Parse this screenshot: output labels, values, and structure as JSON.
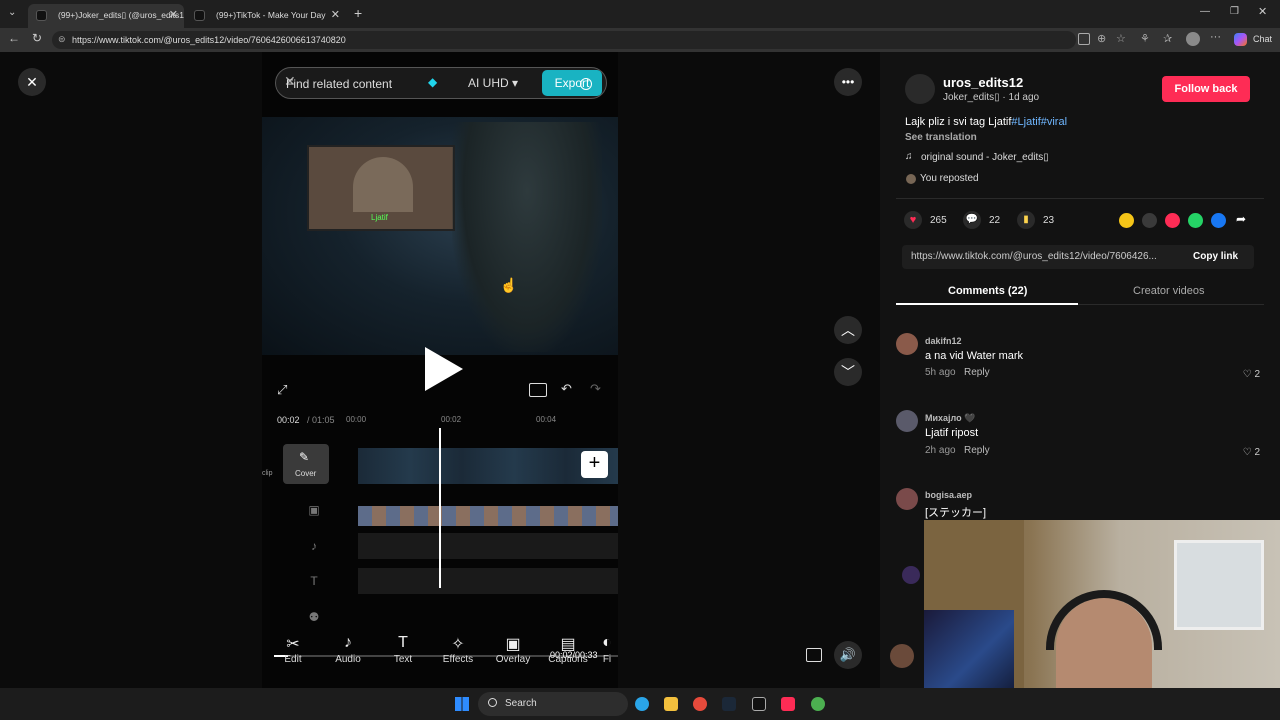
{
  "browser": {
    "tabs": [
      {
        "title": "(99+)Joker_edits▯ (@uros_edits12)",
        "active": true
      },
      {
        "title": "(99+)TikTok - Make Your Day",
        "active": false
      }
    ],
    "url": "https://www.tiktok.com/@uros_edits12/video/7606426006613740820",
    "chat_label": "Chat"
  },
  "editor": {
    "search_placeholder": "Find related content",
    "quality_label": "AI UHD ▾",
    "export_label": "Export",
    "current_time": "00:02",
    "total_time": "/ 01:05",
    "ticks": [
      "00:00",
      "00:02",
      "00:04"
    ],
    "cover_label": "Cover",
    "clip_label": "clip",
    "video_overlay_text": "Ljatif",
    "playback_time": "00:02/00:33",
    "tools": [
      {
        "label": "Edit",
        "icon": "scissors-icon"
      },
      {
        "label": "Audio",
        "icon": "music-note-icon"
      },
      {
        "label": "Text",
        "icon": "text-icon"
      },
      {
        "label": "Effects",
        "icon": "effects-star-icon"
      },
      {
        "label": "Overlay",
        "icon": "overlay-icon"
      },
      {
        "label": "Captions",
        "icon": "captions-icon"
      },
      {
        "label": "Fi",
        "icon": "filter-icon"
      }
    ]
  },
  "post": {
    "username": "uros_edits12",
    "display_meta": "Joker_edits▯ · 1d ago",
    "follow_label": "Follow back",
    "caption_text": "Lajk pliz i svi tag Ljatif",
    "caption_tags": "#Ljatif#viral",
    "see_translation": "See translation",
    "sound": "original sound - Joker_edits▯",
    "reposted": "You reposted",
    "likes": "265",
    "comments": "22",
    "saves": "23",
    "link_url": "https://www.tiktok.com/@uros_edits12/video/7606426...",
    "copy_link": "Copy link",
    "tab_comments": "Comments (22)",
    "tab_creator": "Creator videos",
    "accent_color": "#fe2c55"
  },
  "comments": [
    {
      "name": "dakifn12",
      "text": "a na vid Water mark",
      "time": "5h ago",
      "reply": "Reply",
      "likes": "2"
    },
    {
      "name": "Михајло 🖤",
      "text": "Ljatif ripost",
      "time": "2h ago",
      "reply": "Reply",
      "likes": "2"
    },
    {
      "name": "bogisa.aep",
      "text": "[ステッカー]",
      "time": "",
      "reply": "",
      "likes": ""
    }
  ],
  "taskbar": {
    "search_label": "Search"
  }
}
